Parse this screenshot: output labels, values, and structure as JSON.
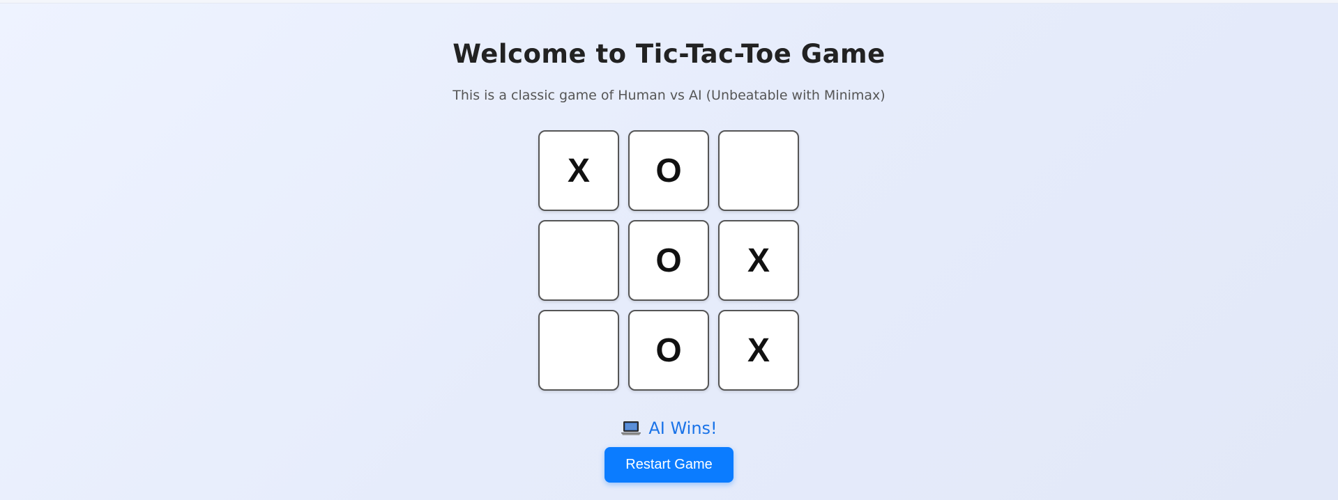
{
  "header": {
    "title": "Welcome to Tic-Tac-Toe Game",
    "subtitle": "This is a classic game of Human vs AI (Unbeatable with Minimax)"
  },
  "board": {
    "cells": [
      "X",
      "O",
      "",
      "",
      "O",
      "X",
      "",
      "O",
      "X"
    ]
  },
  "status": {
    "icon": "laptop-icon",
    "text": "AI Wins!",
    "color": "#1a73e8"
  },
  "controls": {
    "restart_label": "Restart Game",
    "accent": "#0b7cff"
  }
}
